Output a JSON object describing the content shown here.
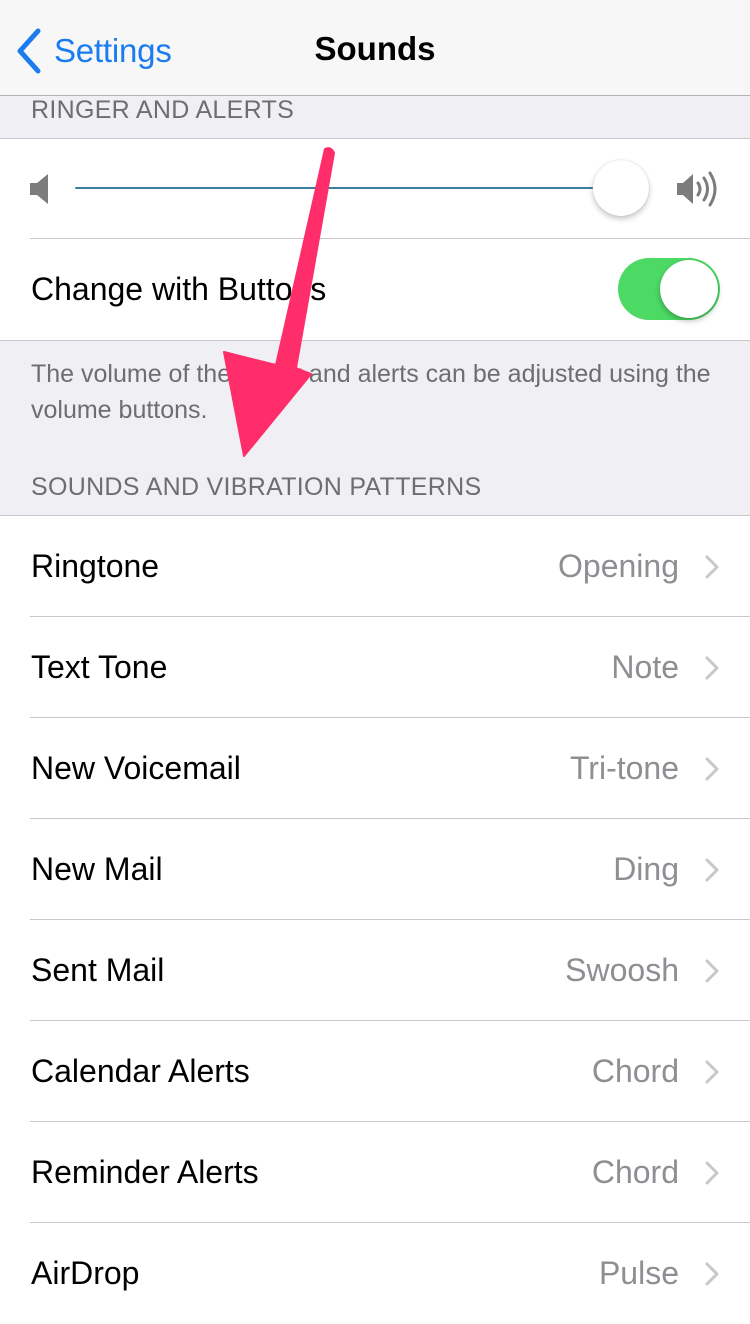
{
  "navbar": {
    "back_label": "Settings",
    "title": "Sounds"
  },
  "ringer_section": {
    "header": "RINGER AND ALERTS",
    "volume_level_percent": 95,
    "change_with_buttons": {
      "label": "Change with Buttons",
      "enabled": true
    },
    "footer": "The volume of the ringer and alerts can be adjusted using the volume buttons."
  },
  "sounds_section": {
    "header": "SOUNDS AND VIBRATION PATTERNS",
    "items": [
      {
        "label": "Ringtone",
        "value": "Opening"
      },
      {
        "label": "Text Tone",
        "value": "Note"
      },
      {
        "label": "New Voicemail",
        "value": "Tri-tone"
      },
      {
        "label": "New Mail",
        "value": "Ding"
      },
      {
        "label": "Sent Mail",
        "value": "Swoosh"
      },
      {
        "label": "Calendar Alerts",
        "value": "Chord"
      },
      {
        "label": "Reminder Alerts",
        "value": "Chord"
      },
      {
        "label": "AirDrop",
        "value": "Pulse"
      }
    ]
  },
  "colors": {
    "accent_blue": "#1b7cf0",
    "toggle_green": "#4cd964",
    "slider_track": "#3a7fa0",
    "annotation_arrow": "#ff2d6a"
  },
  "icons": {
    "back": "chevron-left-icon",
    "volume_low": "speaker-low-icon",
    "volume_high": "speaker-high-icon",
    "disclosure": "chevron-right-icon",
    "annotation": "arrow-annotation-icon"
  }
}
